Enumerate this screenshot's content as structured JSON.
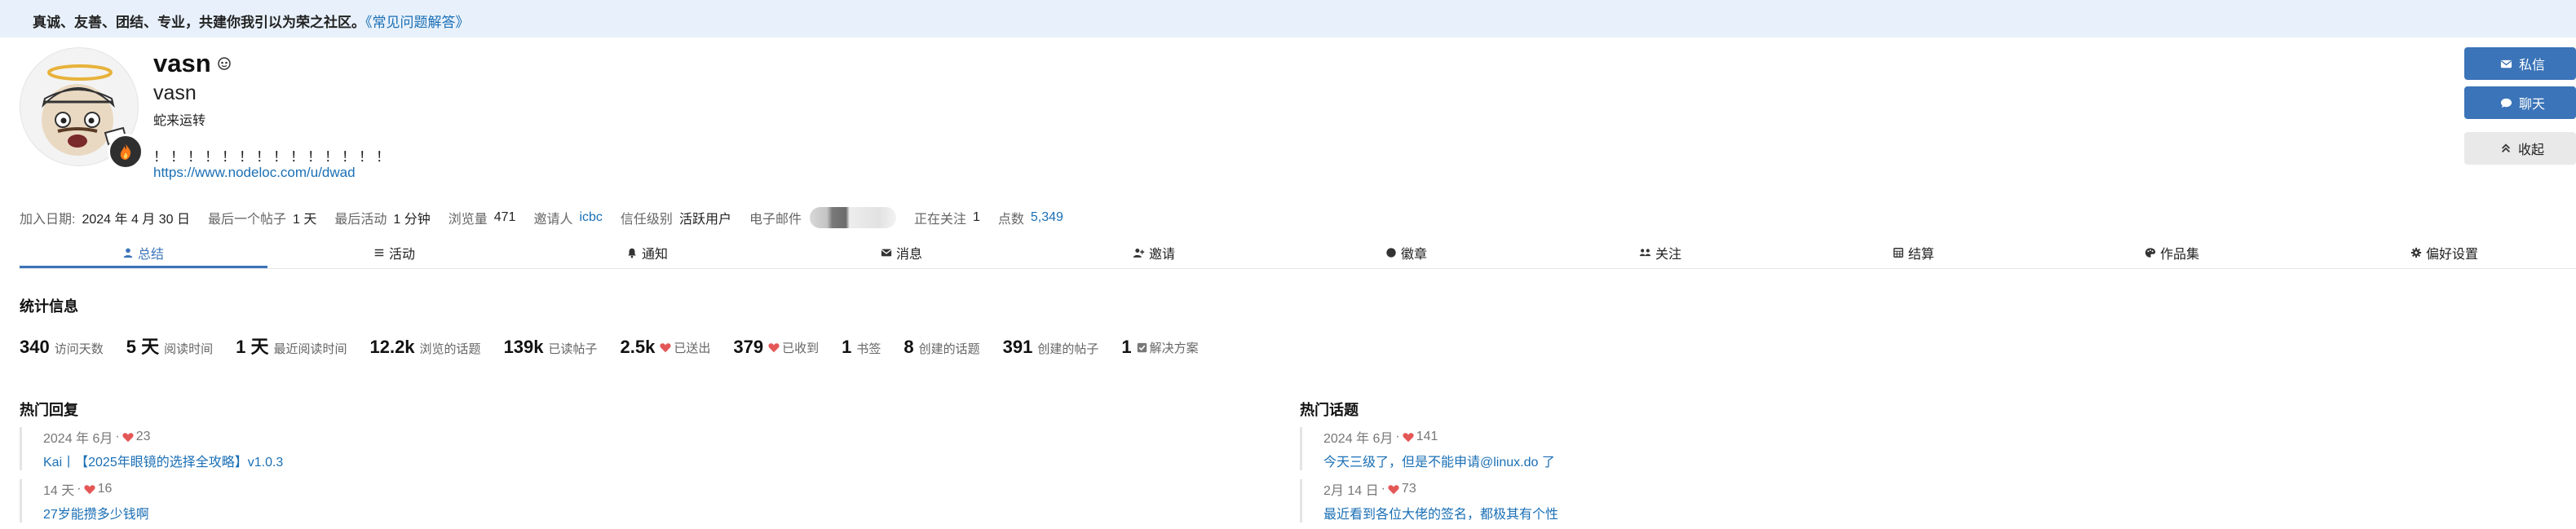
{
  "banner": {
    "text": "真诚、友善、团结、专业，共建你我引以为荣之社区。",
    "link": "《常见问题解答》"
  },
  "profile": {
    "username": "vasn",
    "name": "vasn",
    "title": "蛇来运转",
    "bio": "！！！！！！！！！！！！！！",
    "website": "https://www.nodeloc.com/u/dwad"
  },
  "actions": {
    "message": "私信",
    "chat": "聊天",
    "collapse": "收起"
  },
  "meta": {
    "joined_label": "加入日期:",
    "joined_value": "2024 年 4 月 30 日",
    "last_post_label": "最后一个帖子",
    "last_post_value": "1 天",
    "last_activity_label": "最后活动",
    "last_activity_value": "1 分钟",
    "views_label": "浏览量",
    "views_value": "471",
    "invited_by_label": "邀请人",
    "invited_by_value": "icbc",
    "trust_label": "信任级别",
    "trust_value": "活跃用户",
    "email_label": "电子邮件",
    "following_label": "正在关注",
    "following_value": "1",
    "points_label": "点数",
    "points_value": "5,349"
  },
  "nav": {
    "tabs": [
      {
        "label": "总结",
        "icon": "user-icon"
      },
      {
        "label": "活动",
        "icon": "list-icon"
      },
      {
        "label": "通知",
        "icon": "bell-icon"
      },
      {
        "label": "消息",
        "icon": "envelope-icon"
      },
      {
        "label": "邀请",
        "icon": "user-plus-icon"
      },
      {
        "label": "徽章",
        "icon": "badge-icon"
      },
      {
        "label": "关注",
        "icon": "follow-icon"
      },
      {
        "label": "结算",
        "icon": "calculator-icon"
      },
      {
        "label": "作品集",
        "icon": "palette-icon"
      },
      {
        "label": "偏好设置",
        "icon": "gear-icon"
      }
    ]
  },
  "stats": {
    "title": "统计信息",
    "items": [
      {
        "value": "340",
        "label": "访问天数"
      },
      {
        "value": "5 天",
        "label": "阅读时间"
      },
      {
        "value": "1 天",
        "label": "最近阅读时间"
      },
      {
        "value": "12.2k",
        "label": "浏览的话题"
      },
      {
        "value": "139k",
        "label": "已读帖子"
      },
      {
        "value": "2.5k",
        "label": "已送出",
        "icon": "heart-icon"
      },
      {
        "value": "379",
        "label": "已收到",
        "icon": "heart-icon"
      },
      {
        "value": "1",
        "label": "书签"
      },
      {
        "value": "8",
        "label": "创建的话题"
      },
      {
        "value": "391",
        "label": "创建的帖子"
      },
      {
        "value": "1",
        "label": "解决方案",
        "icon": "check-square-icon"
      }
    ]
  },
  "top_replies": {
    "title": "热门回复",
    "items": [
      {
        "date": "2024 年 6月",
        "likes": "23",
        "title": "Kai丨【2025年眼镜的选择全攻略】v1.0.3"
      },
      {
        "date": "14 天",
        "likes": "16",
        "title": "27岁能攒多少钱啊"
      }
    ]
  },
  "top_topics": {
    "title": "热门话题",
    "items": [
      {
        "date": "2024 年 6月",
        "likes": "141",
        "title": "今天三级了，但是不能申请@linux.do 了"
      },
      {
        "date": "2月 14 日",
        "likes": "73",
        "title": "最近看到各位大佬的签名，都极其有个性"
      }
    ]
  },
  "colors": {
    "accent": "#3b74b8",
    "link": "#1a6fb5",
    "heart": "#e45757",
    "banner_bg": "#e8f1fb"
  }
}
